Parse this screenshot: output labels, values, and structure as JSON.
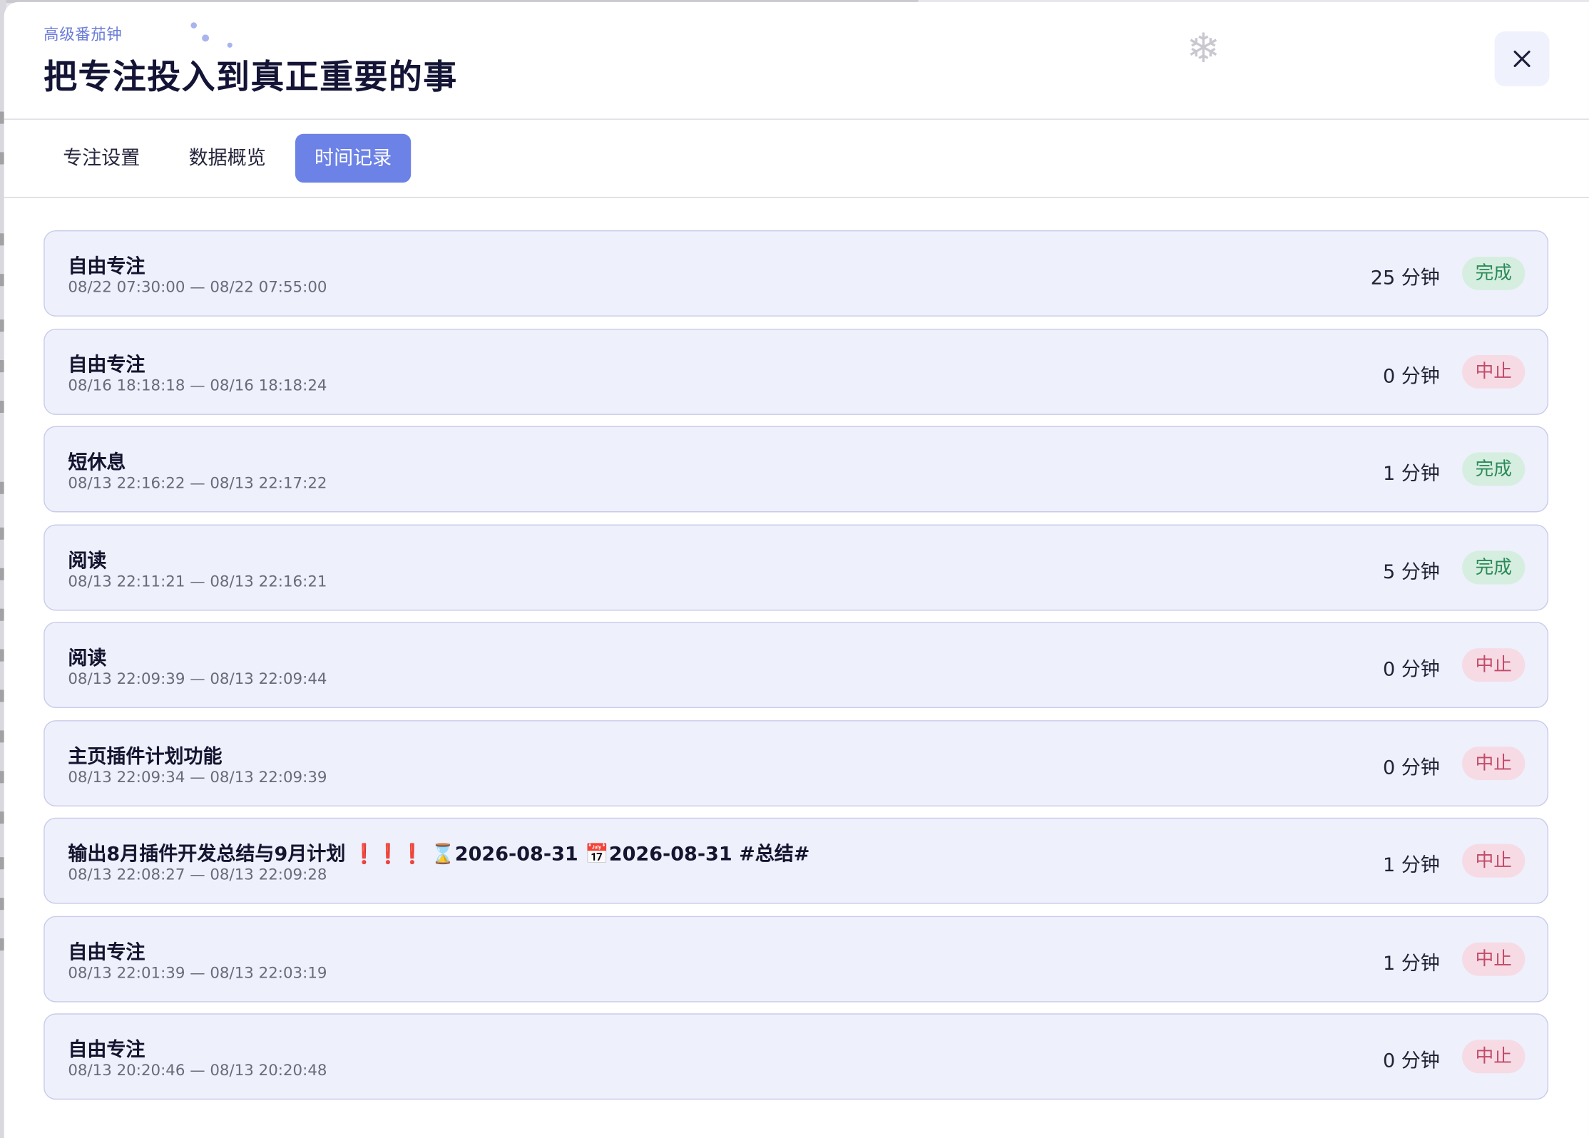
{
  "dialog": {
    "subtitle": "高级番茄钟",
    "title": "把专注投入到真正重要的事",
    "snowflake_icon": "snowflake-icon",
    "close_icon": "close-icon"
  },
  "tabs": [
    {
      "label": "专注设置",
      "active": false
    },
    {
      "label": "数据概览",
      "active": false
    },
    {
      "label": "时间记录",
      "active": true
    }
  ],
  "colors": {
    "accent": "#6c82e6",
    "title": "#141436",
    "row_bg": "#eef0fc",
    "done_badge_bg": "#d6eedf",
    "done_badge_text": "#2c8a5a",
    "stop_badge_bg": "#f6dbe4",
    "stop_badge_text": "#c24a6a"
  },
  "records": [
    {
      "name": "自由专注",
      "time": "08/22 07:30:00 — 08/22 07:55:00",
      "duration": "25 分钟",
      "status": "完成",
      "status_type": "done"
    },
    {
      "name": "自由专注",
      "time": "08/16 18:18:18 — 08/16 18:18:24",
      "duration": "0 分钟",
      "status": "中止",
      "status_type": "stop"
    },
    {
      "name": "短休息",
      "time": "08/13 22:16:22 — 08/13 22:17:22",
      "duration": "1 分钟",
      "status": "完成",
      "status_type": "done"
    },
    {
      "name": "阅读",
      "time": "08/13 22:11:21 — 08/13 22:16:21",
      "duration": "5 分钟",
      "status": "完成",
      "status_type": "done"
    },
    {
      "name": "阅读",
      "time": "08/13 22:09:39 — 08/13 22:09:44",
      "duration": "0 分钟",
      "status": "中止",
      "status_type": "stop"
    },
    {
      "name": "主页插件计划功能",
      "time": "08/13 22:09:34 — 08/13 22:09:39",
      "duration": "0 分钟",
      "status": "中止",
      "status_type": "stop"
    },
    {
      "name": "输出8月插件开发总结与9月计划 ❗❗❗ ⌛2026-08-31 📅2026-08-31 #总结#",
      "time": "08/13 22:08:27 — 08/13 22:09:28",
      "duration": "1 分钟",
      "status": "中止",
      "status_type": "stop"
    },
    {
      "name": "自由专注",
      "time": "08/13 22:01:39 — 08/13 22:03:19",
      "duration": "1 分钟",
      "status": "中止",
      "status_type": "stop"
    },
    {
      "name": "自由专注",
      "time": "08/13 20:20:46 — 08/13 20:20:48",
      "duration": "0 分钟",
      "status": "中止",
      "status_type": "stop"
    }
  ]
}
